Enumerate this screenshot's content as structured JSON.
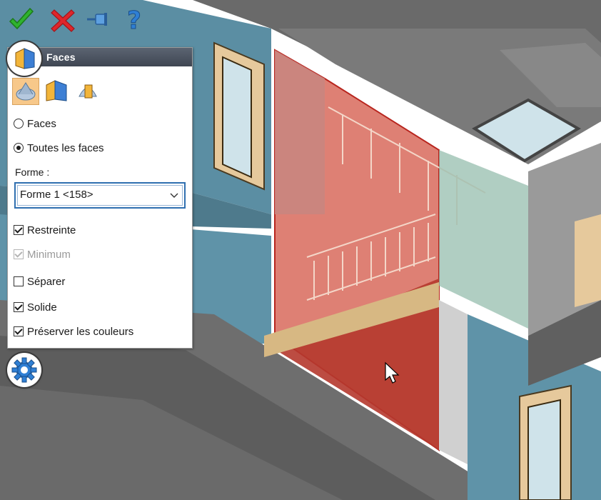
{
  "toolbar": {
    "accept_icon": "green-checkmark-icon",
    "cancel_icon": "red-x-icon",
    "pin_icon": "pushpin-icon",
    "help_icon": "question-mark-icon"
  },
  "panel": {
    "title": "Faces",
    "title_icon": "faces-tool-icon",
    "mode_icons": [
      "face-select-mode-icon",
      "solid-faces-mode-icon",
      "section-mode-icon"
    ],
    "radio_options": [
      {
        "label": "Faces",
        "checked": false
      },
      {
        "label": "Toutes les faces",
        "checked": true
      }
    ],
    "forme_label": "Forme :",
    "forme_value": "Forme 1 <158>",
    "checkboxes": [
      {
        "label": "Restreinte",
        "checked": true,
        "disabled": false
      },
      {
        "label": "Minimum",
        "checked": true,
        "disabled": true
      },
      {
        "label": "Séparer",
        "checked": false,
        "disabled": false
      },
      {
        "label": "Solide",
        "checked": true,
        "disabled": false
      },
      {
        "label": "Préserver les couleurs",
        "checked": true,
        "disabled": false
      }
    ]
  },
  "settings_icon": "gear-icon",
  "colors": {
    "accent": "#2f6fb0",
    "header": "#4a515e",
    "highlight_face": "#c0392b",
    "wall_glass": "#5b8ea3",
    "floor_slab": "#6e6e6e"
  }
}
